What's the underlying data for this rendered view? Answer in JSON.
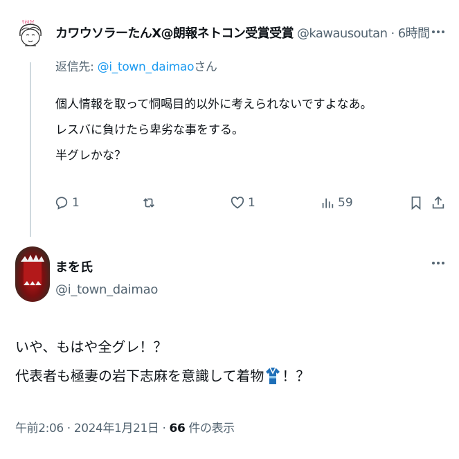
{
  "reply": {
    "display_name": "カワウソラーたんX@朗報ネトコン受賞受賞",
    "handle": "@kawausoutan",
    "separator": "·",
    "time": "6時間",
    "replying_to_prefix": "返信先: ",
    "replying_to_handle": "@i_town_daimao",
    "replying_to_suffix": "さん",
    "avatar_text": "ﾘｵｷﾗｲ",
    "body_lines": [
      "個人情報を取って恫喝目的以外に考えられないですよなあ。",
      "レスバに負けたら卑劣な事をする。",
      "半グレかな？"
    ],
    "actions": {
      "reply_count": "1",
      "retweet_count": "",
      "like_count": "1",
      "view_count": "59"
    }
  },
  "main": {
    "display_name": "まを氏",
    "handle": "@i_town_daimao",
    "body_line1": "いや、もはや全グレ！？",
    "body_line2_before": "代表者も極妻の岩下志麻を意識して着物",
    "body_line2_after": "！？",
    "meta_time": "午前2:06 · 2024年1月21日 · ",
    "meta_views": "66",
    "meta_views_suffix": " 件の表示"
  },
  "colors": {
    "text_primary": "#0f1419",
    "text_secondary": "#536471",
    "link": "#1d9bf0",
    "thread_line": "#cfd9de"
  }
}
